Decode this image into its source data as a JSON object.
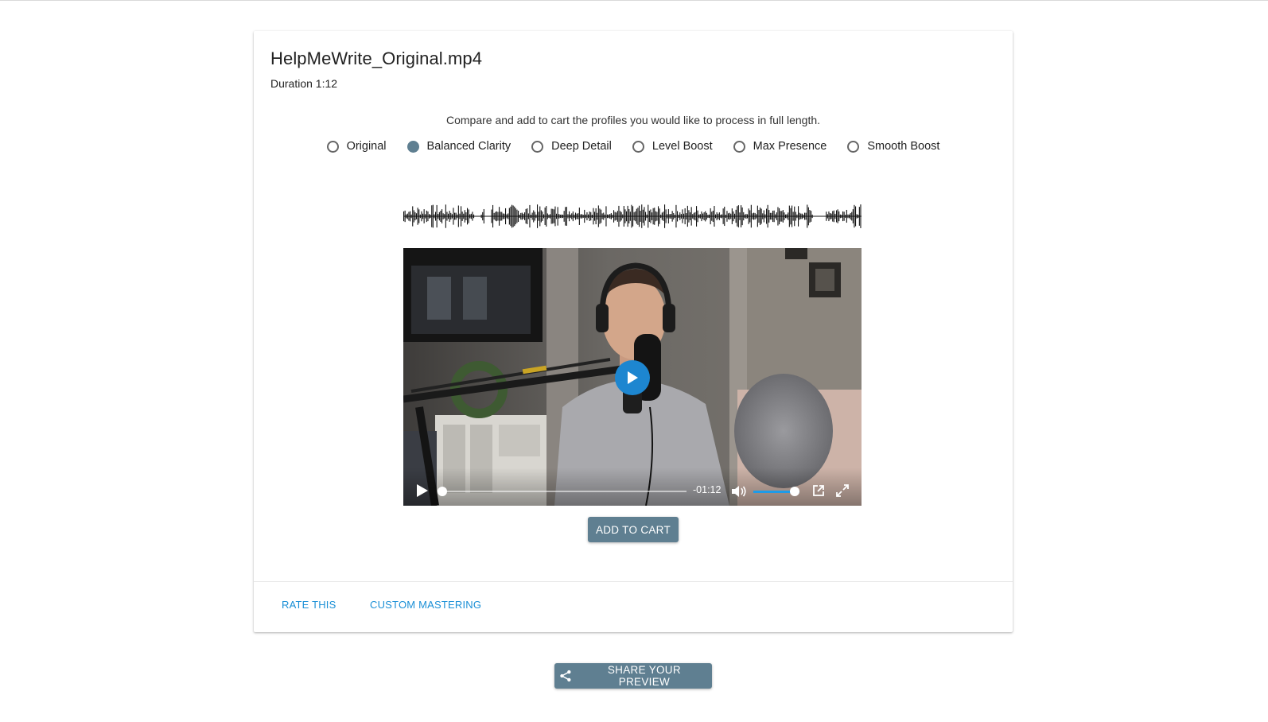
{
  "file": {
    "title": "HelpMeWrite_Original.mp4",
    "duration": "Duration 1:12"
  },
  "instructions": "Compare and add to cart the profiles you would like to process in full length.",
  "profiles": [
    {
      "label": "Original",
      "selected": false
    },
    {
      "label": "Balanced Clarity",
      "selected": true
    },
    {
      "label": "Deep Detail",
      "selected": false
    },
    {
      "label": "Level Boost",
      "selected": false
    },
    {
      "label": "Max Presence",
      "selected": false
    },
    {
      "label": "Smooth Boost",
      "selected": false
    }
  ],
  "player": {
    "time_remaining": "-01:12",
    "progress": 0,
    "volume": 0.9
  },
  "buttons": {
    "add_to_cart": "ADD TO CART",
    "share": "SHARE YOUR PREVIEW"
  },
  "footer_links": {
    "rate": "RATE THIS",
    "custom_mastering": "CUSTOM MASTERING"
  },
  "colors": {
    "accent": "#5f7f91",
    "link": "#1a8fd6",
    "play": "#1d86d0"
  }
}
